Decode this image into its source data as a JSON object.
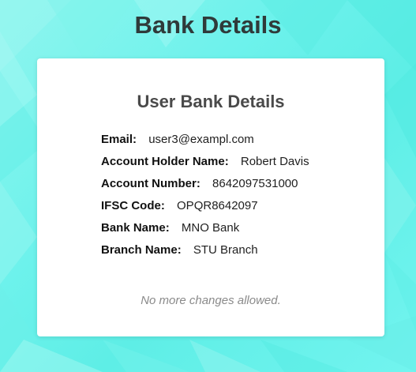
{
  "page": {
    "title": "Bank Details",
    "background_color": "#6ef2ec"
  },
  "card": {
    "title": "User Bank Details",
    "rows": [
      {
        "label": "Email:",
        "value": "user3@exampl.com"
      },
      {
        "label": "Account Holder Name:",
        "value": "Robert Davis"
      },
      {
        "label": "Account Number:",
        "value": "8642097531000"
      },
      {
        "label": "IFSC Code:",
        "value": "OPQR8642097"
      },
      {
        "label": "Bank Name:",
        "value": "MNO Bank"
      },
      {
        "label": "Branch Name:",
        "value": "STU Branch"
      }
    ],
    "note": "No more changes allowed."
  }
}
